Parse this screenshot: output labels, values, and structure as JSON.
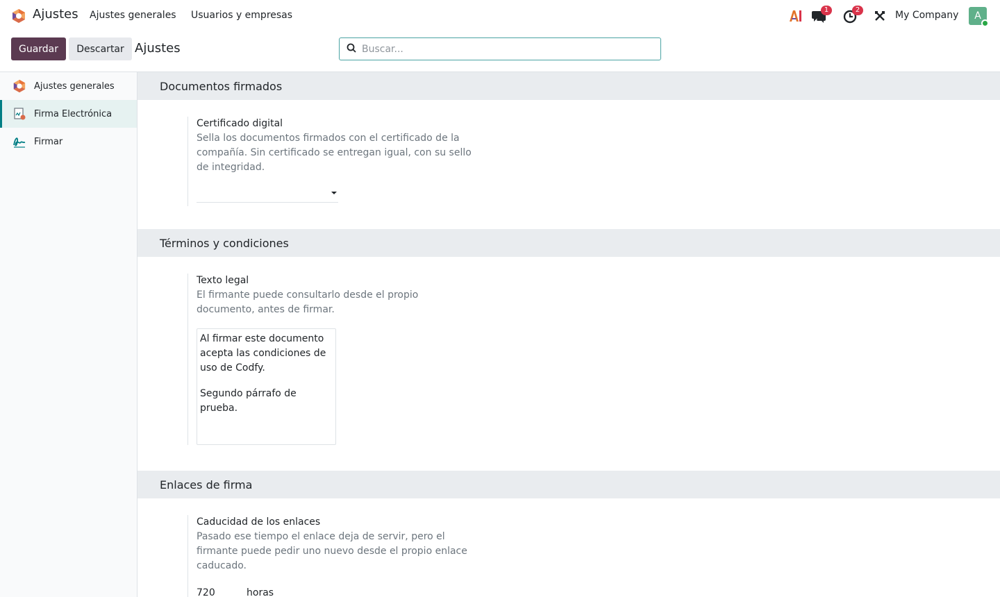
{
  "navbar": {
    "app_name": "Ajustes",
    "menu": [
      "Ajustes generales",
      "Usuarios y empresas"
    ],
    "badges": {
      "messages": "1",
      "activities": "2"
    },
    "company": "My Company",
    "avatar_letter": "A"
  },
  "control_panel": {
    "save_label": "Guardar",
    "discard_label": "Descartar",
    "title": "Ajustes",
    "search_placeholder": "Buscar..."
  },
  "sidebar": {
    "items": [
      {
        "label": "Ajustes generales",
        "icon": "odoo-settings-icon"
      },
      {
        "label": "Firma Electrónica",
        "icon": "electronic-signature-icon",
        "active": true
      },
      {
        "label": "Firmar",
        "icon": "sign-icon"
      }
    ]
  },
  "sections": {
    "documents": {
      "title": "Documentos firmados",
      "setting_label": "Certificado digital",
      "setting_help": "Sella los documentos firmados con el certificado de la compañía. Sin certificado se entregan igual, con su sello de integridad.",
      "select_value": ""
    },
    "terms": {
      "title": "Términos y condiciones",
      "setting_label": "Texto legal",
      "setting_help": "El firmante puede consultarlo desde el propio documento, antes de firmar.",
      "paragraph_1": "Al firmar este documento acepta las condiciones de uso de Codfy.",
      "paragraph_2": "Segundo párrafo de prueba."
    },
    "links": {
      "title": "Enlaces de firma",
      "setting_label": "Caducidad de los enlaces",
      "setting_help": "Pasado ese tiempo el enlace deja de servir, pero el firmante puede pedir uno nuevo desde el propio enlace caducado.",
      "value": "720",
      "unit": "horas"
    }
  },
  "colors": {
    "primary": "#5b3a51",
    "accent": "#017e84",
    "badge": "#d9334a",
    "section_bg": "#e9ecef"
  }
}
